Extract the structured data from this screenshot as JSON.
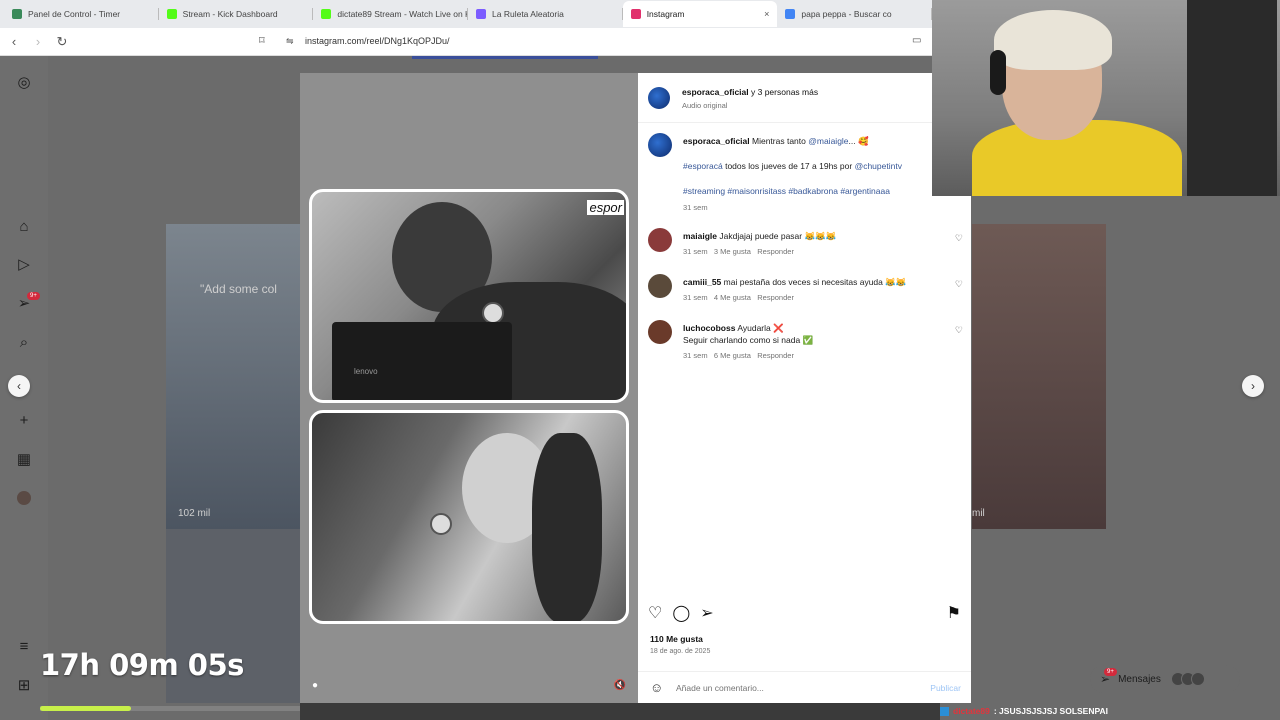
{
  "browser": {
    "tabs": [
      {
        "title": "Panel de Control - Timer",
        "color": "#3a8a5a",
        "active": false
      },
      {
        "title": "Stream - Kick Dashboard",
        "color": "#53fc18",
        "active": false
      },
      {
        "title": "dictate89 Stream - Watch Live on Ki",
        "color": "#53fc18",
        "active": false
      },
      {
        "title": "La Ruleta Aleatoria",
        "color": "#7b5cff",
        "active": false
      },
      {
        "title": "Instagram",
        "color": "#e1306c",
        "active": true
      },
      {
        "title": "papa peppa - Buscar co",
        "color": "#4285f4",
        "active": false
      }
    ],
    "close_glyph": "×",
    "url": "instagram.com/reel/DNg1KqOPJDu/"
  },
  "reel": {
    "watermark": "espor",
    "laptop_brand": "lenovo"
  },
  "background": {
    "left_caption": "\"Add some col",
    "left_views": "102 mil",
    "right_views": "mil"
  },
  "post": {
    "header_user": "esporaca_oficial",
    "header_rest": "y 3 personas más",
    "audio": "Audio original",
    "caption_user": "esporaca_oficial",
    "caption_text": "Mientras tanto",
    "caption_mention": "@maiaigle",
    "caption_end": "... 🥰",
    "line2_tag": "#esporacá",
    "line2_text": "todos los jueves de 17 a 19hs por",
    "line2_mention": "@chupetintv",
    "line3": "#streaming #maisonrisitass #badkabrona #argentinaaa",
    "caption_time": "31 sem",
    "comments": [
      {
        "user": "maiaigle",
        "text": "Jakdjajaj puede pasar 😹😹😹",
        "text2": "",
        "time": "31 sem",
        "likes": "3 Me gusta",
        "reply": "Responder",
        "color": "#8a3a3a"
      },
      {
        "user": "camiii_55",
        "text": "mai pestaña dos veces si necesitas ayuda 😹😹",
        "text2": "",
        "time": "31 sem",
        "likes": "4 Me gusta",
        "reply": "Responder",
        "color": "#5a4a3a"
      },
      {
        "user": "luchocoboss",
        "text": "Ayudarla ❌",
        "text2": "Seguir charlando como si nada ✅",
        "time": "31 sem",
        "likes": "6 Me gusta",
        "reply": "Responder",
        "color": "#6a3a2a"
      }
    ],
    "likes": "110 Me gusta",
    "date": "18 de ago. de 2025",
    "comment_placeholder": "Añade un comentario...",
    "publish": "Publicar"
  },
  "overlay": {
    "timer": "17h 09m 05s",
    "timer_progress": 0.35,
    "messages_label": "Mensajes",
    "messages_badge": "9+",
    "sidebar_badge": "9+",
    "ticker_user": "dictate89",
    "ticker_text": ": JSUSJSJSJSJ SOLSENPAI"
  }
}
